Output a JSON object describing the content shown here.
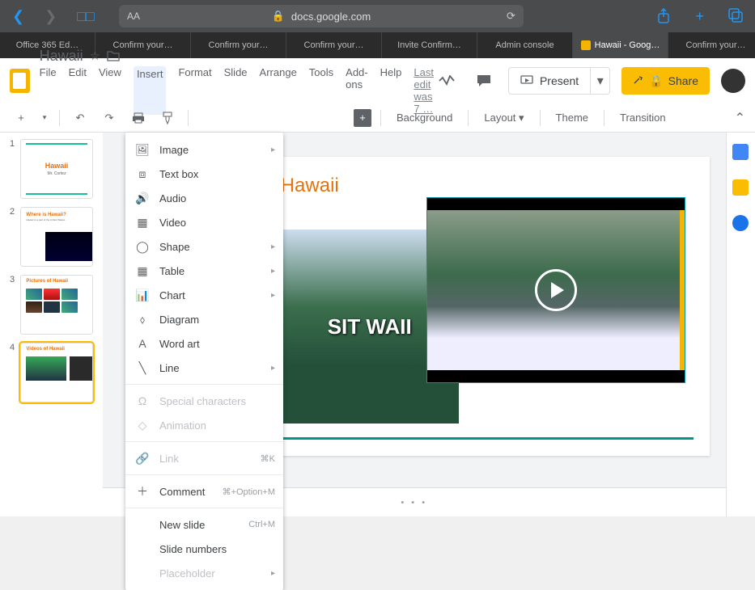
{
  "browser": {
    "url": "docs.google.com",
    "tabs": [
      "Office 365 Ed…",
      "Confirm your…",
      "Confirm your…",
      "Confirm your…",
      "Invite Confirm…",
      "Admin console",
      "Hawaii - Goog…",
      "Confirm your…"
    ],
    "active_tab_index": 6
  },
  "doc": {
    "title": "Hawaii",
    "last_edit": "Last edit was 7 …"
  },
  "menus": [
    "File",
    "Edit",
    "View",
    "Insert",
    "Format",
    "Slide",
    "Arrange",
    "Tools",
    "Add-ons",
    "Help"
  ],
  "open_menu_index": 3,
  "header_actions": {
    "present": "Present",
    "share": "Share"
  },
  "toolbar": {
    "background": "Background",
    "layout": "Layout",
    "theme": "Theme",
    "transition": "Transition"
  },
  "insert_menu": [
    {
      "icon": "image",
      "label": "Image",
      "submenu": true
    },
    {
      "icon": "textbox",
      "label": "Text box"
    },
    {
      "icon": "audio",
      "label": "Audio"
    },
    {
      "icon": "video",
      "label": "Video"
    },
    {
      "icon": "shape",
      "label": "Shape",
      "submenu": true
    },
    {
      "icon": "table",
      "label": "Table",
      "submenu": true
    },
    {
      "icon": "chart",
      "label": "Chart",
      "submenu": true
    },
    {
      "icon": "diagram",
      "label": "Diagram"
    },
    {
      "icon": "wordart",
      "label": "Word art"
    },
    {
      "icon": "line",
      "label": "Line",
      "submenu": true
    },
    {
      "sep": true
    },
    {
      "icon": "specialchar",
      "label": "Special characters",
      "disabled": true
    },
    {
      "icon": "animation",
      "label": "Animation",
      "disabled": true
    },
    {
      "sep": true
    },
    {
      "icon": "link",
      "label": "Link",
      "disabled": true,
      "shortcut": "⌘K"
    },
    {
      "sep": true
    },
    {
      "icon": "comment",
      "label": "Comment",
      "shortcut": "⌘+Option+M"
    },
    {
      "sep": true
    },
    {
      "icon": "",
      "label": "New slide",
      "shortcut": "Ctrl+M"
    },
    {
      "icon": "",
      "label": "Slide numbers"
    },
    {
      "icon": "",
      "label": "Placeholder",
      "disabled": true,
      "submenu": true
    }
  ],
  "thumbnails": [
    {
      "num": "1",
      "title": "Hawaii",
      "subtitle": "Mr. Cortez"
    },
    {
      "num": "2",
      "title": "Where is Hawaii?"
    },
    {
      "num": "3",
      "title": "Pictures of Hawaii"
    },
    {
      "num": "4",
      "title": "Videos of Hawaii",
      "selected": true
    }
  ],
  "slide_canvas": {
    "title_fragment": "Hawaii",
    "image_text": "SIT\nWAII"
  }
}
